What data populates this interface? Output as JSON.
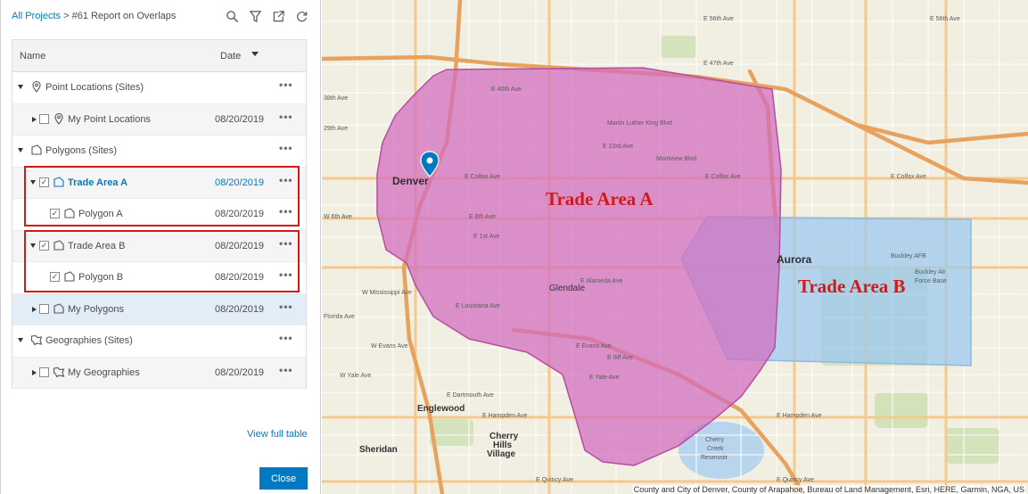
{
  "header": {
    "breadcrumb_link": "All Projects",
    "breadcrumb_sep": " > ",
    "breadcrumb_current": "#61 Report on Overlaps",
    "tools": [
      "search-icon",
      "filter-icon",
      "export-icon",
      "refresh-icon"
    ]
  },
  "table": {
    "col_name": "Name",
    "col_date": "Date",
    "more": "•••",
    "rows": [
      {
        "label": "Point Locations (Sites)",
        "date": ""
      },
      {
        "label": "My Point Locations",
        "date": "08/20/2019"
      },
      {
        "label": "Polygons (Sites)",
        "date": ""
      },
      {
        "label": "Trade Area A",
        "date": "08/20/2019"
      },
      {
        "label": "Polygon A",
        "date": "08/20/2019"
      },
      {
        "label": "Trade Area B",
        "date": "08/20/2019"
      },
      {
        "label": "Polygon B",
        "date": "08/20/2019"
      },
      {
        "label": "My Polygons",
        "date": "08/20/2019"
      },
      {
        "label": "Geographies (Sites)",
        "date": ""
      },
      {
        "label": "My Geographies",
        "date": "08/20/2019"
      }
    ]
  },
  "footer": {
    "view_full_table": "View full table",
    "close": "Close"
  },
  "map": {
    "area_a_title": "Trade Area A",
    "area_b_title": "Trade Area B",
    "area_a_color": "#d36bbf",
    "area_b_color": "#9ec8ef",
    "places": {
      "denver": "Denver",
      "aurora": "Aurora",
      "glendale": "Glendale",
      "englewood": "Englewood",
      "cherry_hills_1": "Cherry",
      "cherry_hills_2": "Hills",
      "cherry_hills_3": "Village",
      "sheridan": "Sheridan"
    },
    "streets": {
      "e56": "E 56th Ave",
      "e56b": "E 56th Ave",
      "e47": "E 47th Ave",
      "e40": "E 40th Ave",
      "e38": "38th Ave",
      "mlk": "Martin Luther King Blvd",
      "e29": "29th Ave",
      "e23": "E 23rd Ave",
      "montview": "Montview Blvd",
      "colfax": "E Colfax Ave",
      "colfax2": "E Colfax Ave",
      "colfax3": "E Colfax Ave",
      "w6th": "W 6th Ave",
      "e6th": "E 6th Ave",
      "e1st": "E 1st Ave",
      "alameda": "E Alameda Ave",
      "mississippi": "W Mississippi Ave",
      "louisiana": "E Louisiana Ave",
      "florida": "Florida Ave",
      "evans": "E Evans Ave",
      "wevans": "W Evans Ave",
      "iliff": "E Iliff Ave",
      "yale": "E Yale Ave",
      "wyale": "W Yale Ave",
      "dartmouth": "E Dartmouth Ave",
      "hampden": "E Hampden Ave",
      "hampden2": "E Hampden Ave",
      "quincy": "E Quincy Ave",
      "quincy2": "E Quincy Ave",
      "cherry_creek_1": "Cherry",
      "cherry_creek_2": "Creek",
      "cherry_creek_3": "Reservoir",
      "buckley": "Buckley AFB",
      "buckley2": "Buckley Air",
      "buckley3": "Force Base"
    },
    "attribution": "County and City of Denver, County of Arapahoe, Bureau of Land Management, Esri, HERE, Garmin, NGA, US"
  }
}
